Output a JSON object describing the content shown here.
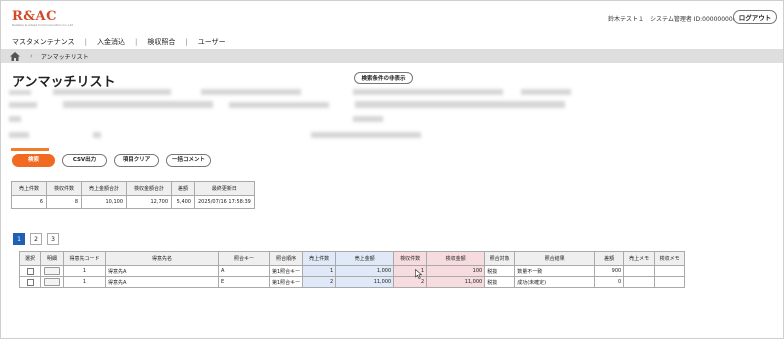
{
  "header": {
    "logo_text": "R&AC",
    "logo_sub": "Reliable & Adept Communication Co.,Ltd",
    "user_info": "鈴木テスト１　システム管理者 ID:0000000001",
    "logout_label": "ログアウト"
  },
  "menu": [
    "マスタメンテナンス",
    "入金消込",
    "検収照合",
    "ユーザー"
  ],
  "breadcrumb": {
    "current": "アンマッチリスト"
  },
  "page_title": "アンマッチリスト",
  "hide_condition_label": "検索条件の非表示",
  "actions": {
    "search": "検索",
    "csv": "CSV出力",
    "clear": "項目クリア",
    "bulk_comment": "一括コメント"
  },
  "summary": {
    "headers": [
      "売上件数",
      "検収件数",
      "売上金額合計",
      "検収金額合計",
      "差額"
    ],
    "values": [
      "6",
      "8",
      "10,100",
      "12,700",
      "5,400"
    ]
  },
  "last_update": {
    "header": "最終更新日",
    "value": "2025/07/16 17:58:39"
  },
  "pagination": [
    "1",
    "2",
    "3"
  ],
  "grid": {
    "headers": [
      "選択",
      "明細",
      "得意先コード",
      "得意先名",
      "照合キー",
      "照合順序",
      "売上件数",
      "売上金額",
      "検収件数",
      "検収金額",
      "照合対象",
      "照合結果",
      "差額",
      "売上メモ",
      "検収メモ"
    ],
    "rows": [
      [
        "",
        "",
        "1",
        "得意先A",
        "A",
        "第1照合キー",
        "1",
        "1,000",
        "1",
        "100",
        "税抜",
        "数量不一致",
        "900",
        "",
        ""
      ],
      [
        "",
        "",
        "1",
        "得意先A",
        "E",
        "第1照合キー",
        "2",
        "11,000",
        "2",
        "11,000",
        "税抜",
        "成功(未確定)",
        "0",
        "",
        ""
      ]
    ]
  },
  "colors": {
    "accent": "#f26a21",
    "active_page": "#1f5fb5",
    "sales_col": "#dfe9f7",
    "inspection_col": "#f7dcdf"
  },
  "icons": [
    "home-icon",
    "chevron-right-icon",
    "mouse-cursor-icon"
  ]
}
